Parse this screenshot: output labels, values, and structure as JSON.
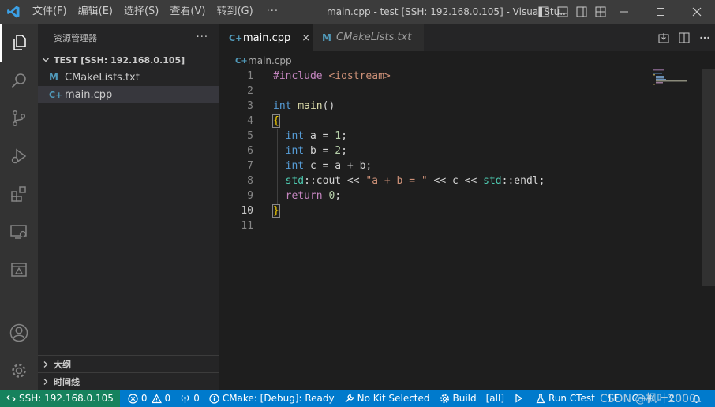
{
  "titlebar": {
    "menu": [
      "文件(F)",
      "编辑(E)",
      "选择(S)",
      "查看(V)",
      "转到(G)"
    ],
    "more": "···",
    "title": "main.cpp - test [SSH: 192.168.0.105] - Visual Stu..."
  },
  "sidebar": {
    "header": "资源管理器",
    "more": "···",
    "folder": "TEST [SSH: 192.168.0.105]",
    "files": [
      {
        "icon": "M",
        "name": "CMakeLists.txt"
      },
      {
        "icon": "C+",
        "name": "main.cpp"
      }
    ],
    "outline": "大纲",
    "timeline": "时间线"
  },
  "tabs": [
    {
      "icon": "C+",
      "label": "main.cpp",
      "close": "×"
    },
    {
      "icon": "M",
      "label": "CMakeLists.txt"
    }
  ],
  "breadcrumb": {
    "icon": "C+",
    "label": "main.cpp"
  },
  "code": {
    "current_line": 10,
    "lines": [
      {
        "n": "1",
        "tokens": [
          {
            "t": "#include",
            "c": "ctl"
          },
          {
            "t": " "
          },
          {
            "t": "<iostream>",
            "c": "str"
          }
        ]
      },
      {
        "n": "2",
        "tokens": []
      },
      {
        "n": "3",
        "tokens": [
          {
            "t": "int",
            "c": "kw"
          },
          {
            "t": " "
          },
          {
            "t": "main",
            "c": "fn"
          },
          {
            "t": "()"
          }
        ]
      },
      {
        "n": "4",
        "tokens": [
          {
            "t": "{",
            "c": "brace match"
          }
        ]
      },
      {
        "n": "5",
        "guide": true,
        "tokens": [
          {
            "t": "  "
          },
          {
            "t": "int",
            "c": "kw"
          },
          {
            "t": " a = "
          },
          {
            "t": "1",
            "c": "num"
          },
          {
            "t": ";"
          }
        ]
      },
      {
        "n": "6",
        "guide": true,
        "tokens": [
          {
            "t": "  "
          },
          {
            "t": "int",
            "c": "kw"
          },
          {
            "t": " b = "
          },
          {
            "t": "2",
            "c": "num"
          },
          {
            "t": ";"
          }
        ]
      },
      {
        "n": "7",
        "guide": true,
        "tokens": [
          {
            "t": "  "
          },
          {
            "t": "int",
            "c": "kw"
          },
          {
            "t": " c = a + b;"
          }
        ]
      },
      {
        "n": "8",
        "guide": true,
        "tokens": [
          {
            "t": "  "
          },
          {
            "t": "std",
            "c": "ns"
          },
          {
            "t": "::cout << "
          },
          {
            "t": "\"a + b = \"",
            "c": "str"
          },
          {
            "t": " << c << "
          },
          {
            "t": "std",
            "c": "ns"
          },
          {
            "t": "::endl;"
          }
        ]
      },
      {
        "n": "9",
        "guide": true,
        "tokens": [
          {
            "t": "  "
          },
          {
            "t": "return",
            "c": "ctl"
          },
          {
            "t": " "
          },
          {
            "t": "0",
            "c": "num"
          },
          {
            "t": ";"
          }
        ]
      },
      {
        "n": "10",
        "tokens": [
          {
            "t": "}",
            "c": "brace match"
          }
        ]
      },
      {
        "n": "11",
        "tokens": []
      }
    ]
  },
  "statusbar": {
    "remote": "SSH: 192.168.0.105",
    "errors": "0",
    "warnings": "0",
    "ports": "0",
    "cmake": "CMake: [Debug]: Ready",
    "kit": "No Kit Selected",
    "build": "Build",
    "target": "[all]",
    "ctest": "Run CTest",
    "eol": "LF",
    "lang": "C++"
  },
  "watermark": "CSDN @枫叶2000",
  "colors": {
    "accent": "#007acc",
    "remote": "#16825d",
    "titlebar": "#3c3c3c",
    "activitybar": "#333333",
    "sidebar": "#252526",
    "editor": "#1e1e1e"
  }
}
